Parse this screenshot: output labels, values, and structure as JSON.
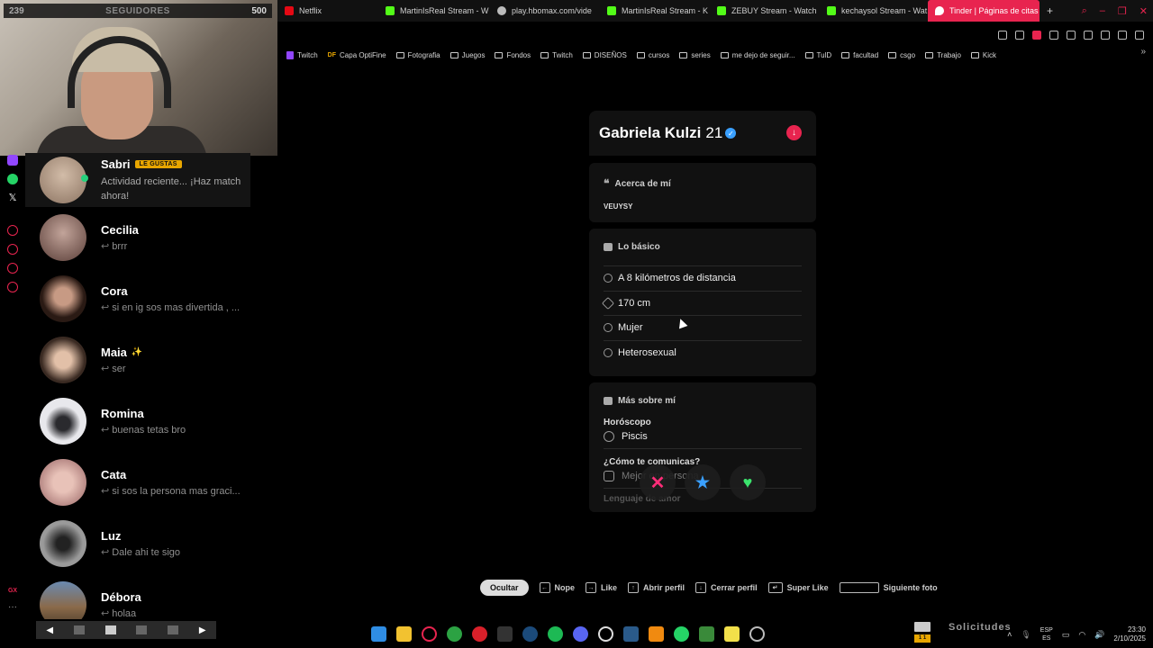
{
  "tabs": [
    {
      "label": "Netflix",
      "color": "#e50914"
    },
    {
      "label": "MartinIsReal Stream - W",
      "color": "#53fc18"
    },
    {
      "label": "play.hbomax.com/vide",
      "color": "#bbbbbb"
    },
    {
      "label": "MartinIsReal Stream - K",
      "color": "#53fc18"
    },
    {
      "label": "ZEBUY Stream - Watch",
      "color": "#53fc18"
    },
    {
      "label": "kechaysol Stream - Wat",
      "color": "#53fc18"
    },
    {
      "label": "Tinder | Páginas de citas",
      "color": "#ffffff"
    }
  ],
  "new_tab": "+",
  "bookmarks": [
    {
      "label": "Twitch",
      "icon": "twitch-icon"
    },
    {
      "label": "Capa OptiFine",
      "icon": "df-icon"
    },
    {
      "label": "Fotografia",
      "icon": "folder-icon"
    },
    {
      "label": "Juegos",
      "icon": "folder-icon"
    },
    {
      "label": "Fondos",
      "icon": "folder-icon"
    },
    {
      "label": "Twitch",
      "icon": "folder-icon"
    },
    {
      "label": "DISEÑOS",
      "icon": "folder-icon"
    },
    {
      "label": "cursos",
      "icon": "folder-icon"
    },
    {
      "label": "series",
      "icon": "folder-icon"
    },
    {
      "label": "me dejo de seguir...",
      "icon": "folder-icon"
    },
    {
      "label": "TulD",
      "icon": "folder-icon"
    },
    {
      "label": "facultad",
      "icon": "folder-icon"
    },
    {
      "label": "csgo",
      "icon": "folder-icon"
    },
    {
      "label": "Trabajo",
      "icon": "folder-icon"
    },
    {
      "label": "Kick",
      "icon": "folder-icon"
    }
  ],
  "followers": {
    "current": "239",
    "label": "SEGUIDORES",
    "goal": "500"
  },
  "matches": [
    {
      "name": "Sabri",
      "badge": "LE GUSTAS",
      "message": "Actividad reciente... ¡Haz match ahora!",
      "avatar_color": "#b39b86",
      "online": true
    },
    {
      "name": "Cecilia",
      "message": "brrr",
      "avatar_color": "#7a5a54"
    },
    {
      "name": "Cora",
      "message": "si en ig sos mas divertida , ...",
      "avatar_color": "#3e2a23"
    },
    {
      "name": "Maia",
      "message": "ser",
      "avatar_color": "#6b5347",
      "emoji": "✨"
    },
    {
      "name": "Romina",
      "message": "buenas tetas bro",
      "avatar_color": "#d8d8dc"
    },
    {
      "name": "Cata",
      "message": "si sos la persona mas graci...",
      "avatar_color": "#d9a8a8"
    },
    {
      "name": "Luz",
      "message": "Dale ahi te sigo",
      "avatar_color": "#555555"
    },
    {
      "name": "Débora",
      "message": "holaa",
      "avatar_color": "#8a6a4a"
    }
  ],
  "profile": {
    "name": "Gabriela Kulzi",
    "age": "21",
    "about_title": "Acerca de mí",
    "bio": "VEUYSY",
    "basics_title": "Lo básico",
    "basics": [
      {
        "label": "A 8 kilómetros de distancia",
        "icon": "location-pin-icon"
      },
      {
        "label": "170 cm",
        "icon": "ruler-icon"
      },
      {
        "label": "Mujer",
        "icon": "person-icon"
      },
      {
        "label": "Heterosexual",
        "icon": "orientation-icon"
      }
    ],
    "more_title": "Más sobre mí",
    "more": [
      {
        "label": "Horóscopo",
        "value": "Piscis",
        "icon": "moon-icon"
      },
      {
        "label": "¿Cómo te comunicas?",
        "value": "Mejor en persona",
        "icon": "chat-icon"
      }
    ],
    "more_cut_label": "Lenguaje de amor"
  },
  "actions": {
    "nope": "✕",
    "super_like": "★",
    "like": "♥"
  },
  "hints": {
    "hide": "Ocultar",
    "nope": "Nope",
    "like": "Like",
    "open_profile": "Abrir perfil",
    "close_profile": "Cerrar perfil",
    "super_like": "Super Like",
    "next_photo": "Siguiente foto"
  },
  "tray": {
    "solicitudes": "Solicitudes",
    "mail_count": "1 1",
    "lang_top": "ESP",
    "lang_bottom": "ES",
    "time": "23:30",
    "date": "2/10/2025"
  },
  "accent": "#e8244f"
}
